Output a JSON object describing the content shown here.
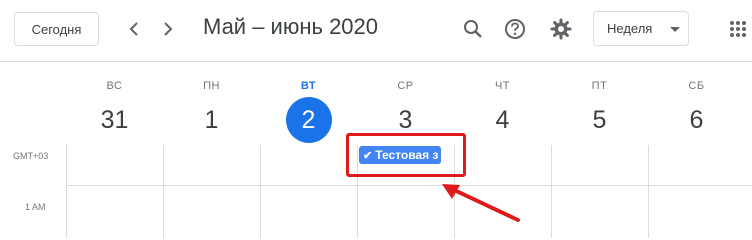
{
  "header": {
    "today_label": "Сегодня",
    "title": "Май – июнь 2020",
    "view_label": "Неделя"
  },
  "days": [
    {
      "dow": "ВС",
      "num": "31",
      "today": false
    },
    {
      "dow": "ПН",
      "num": "1",
      "today": false
    },
    {
      "dow": "ВТ",
      "num": "2",
      "today": true
    },
    {
      "dow": "СР",
      "num": "3",
      "today": false
    },
    {
      "dow": "ЧТ",
      "num": "4",
      "today": false
    },
    {
      "dow": "ПТ",
      "num": "5",
      "today": false
    },
    {
      "dow": "СБ",
      "num": "6",
      "today": false
    }
  ],
  "grid": {
    "timezone": "GMT+03",
    "hour_label": "1 AM"
  },
  "event": {
    "title": "Тестовая з"
  },
  "colors": {
    "accent": "#1a73e8",
    "event": "#4285f4",
    "annotation": "#e0191d"
  }
}
